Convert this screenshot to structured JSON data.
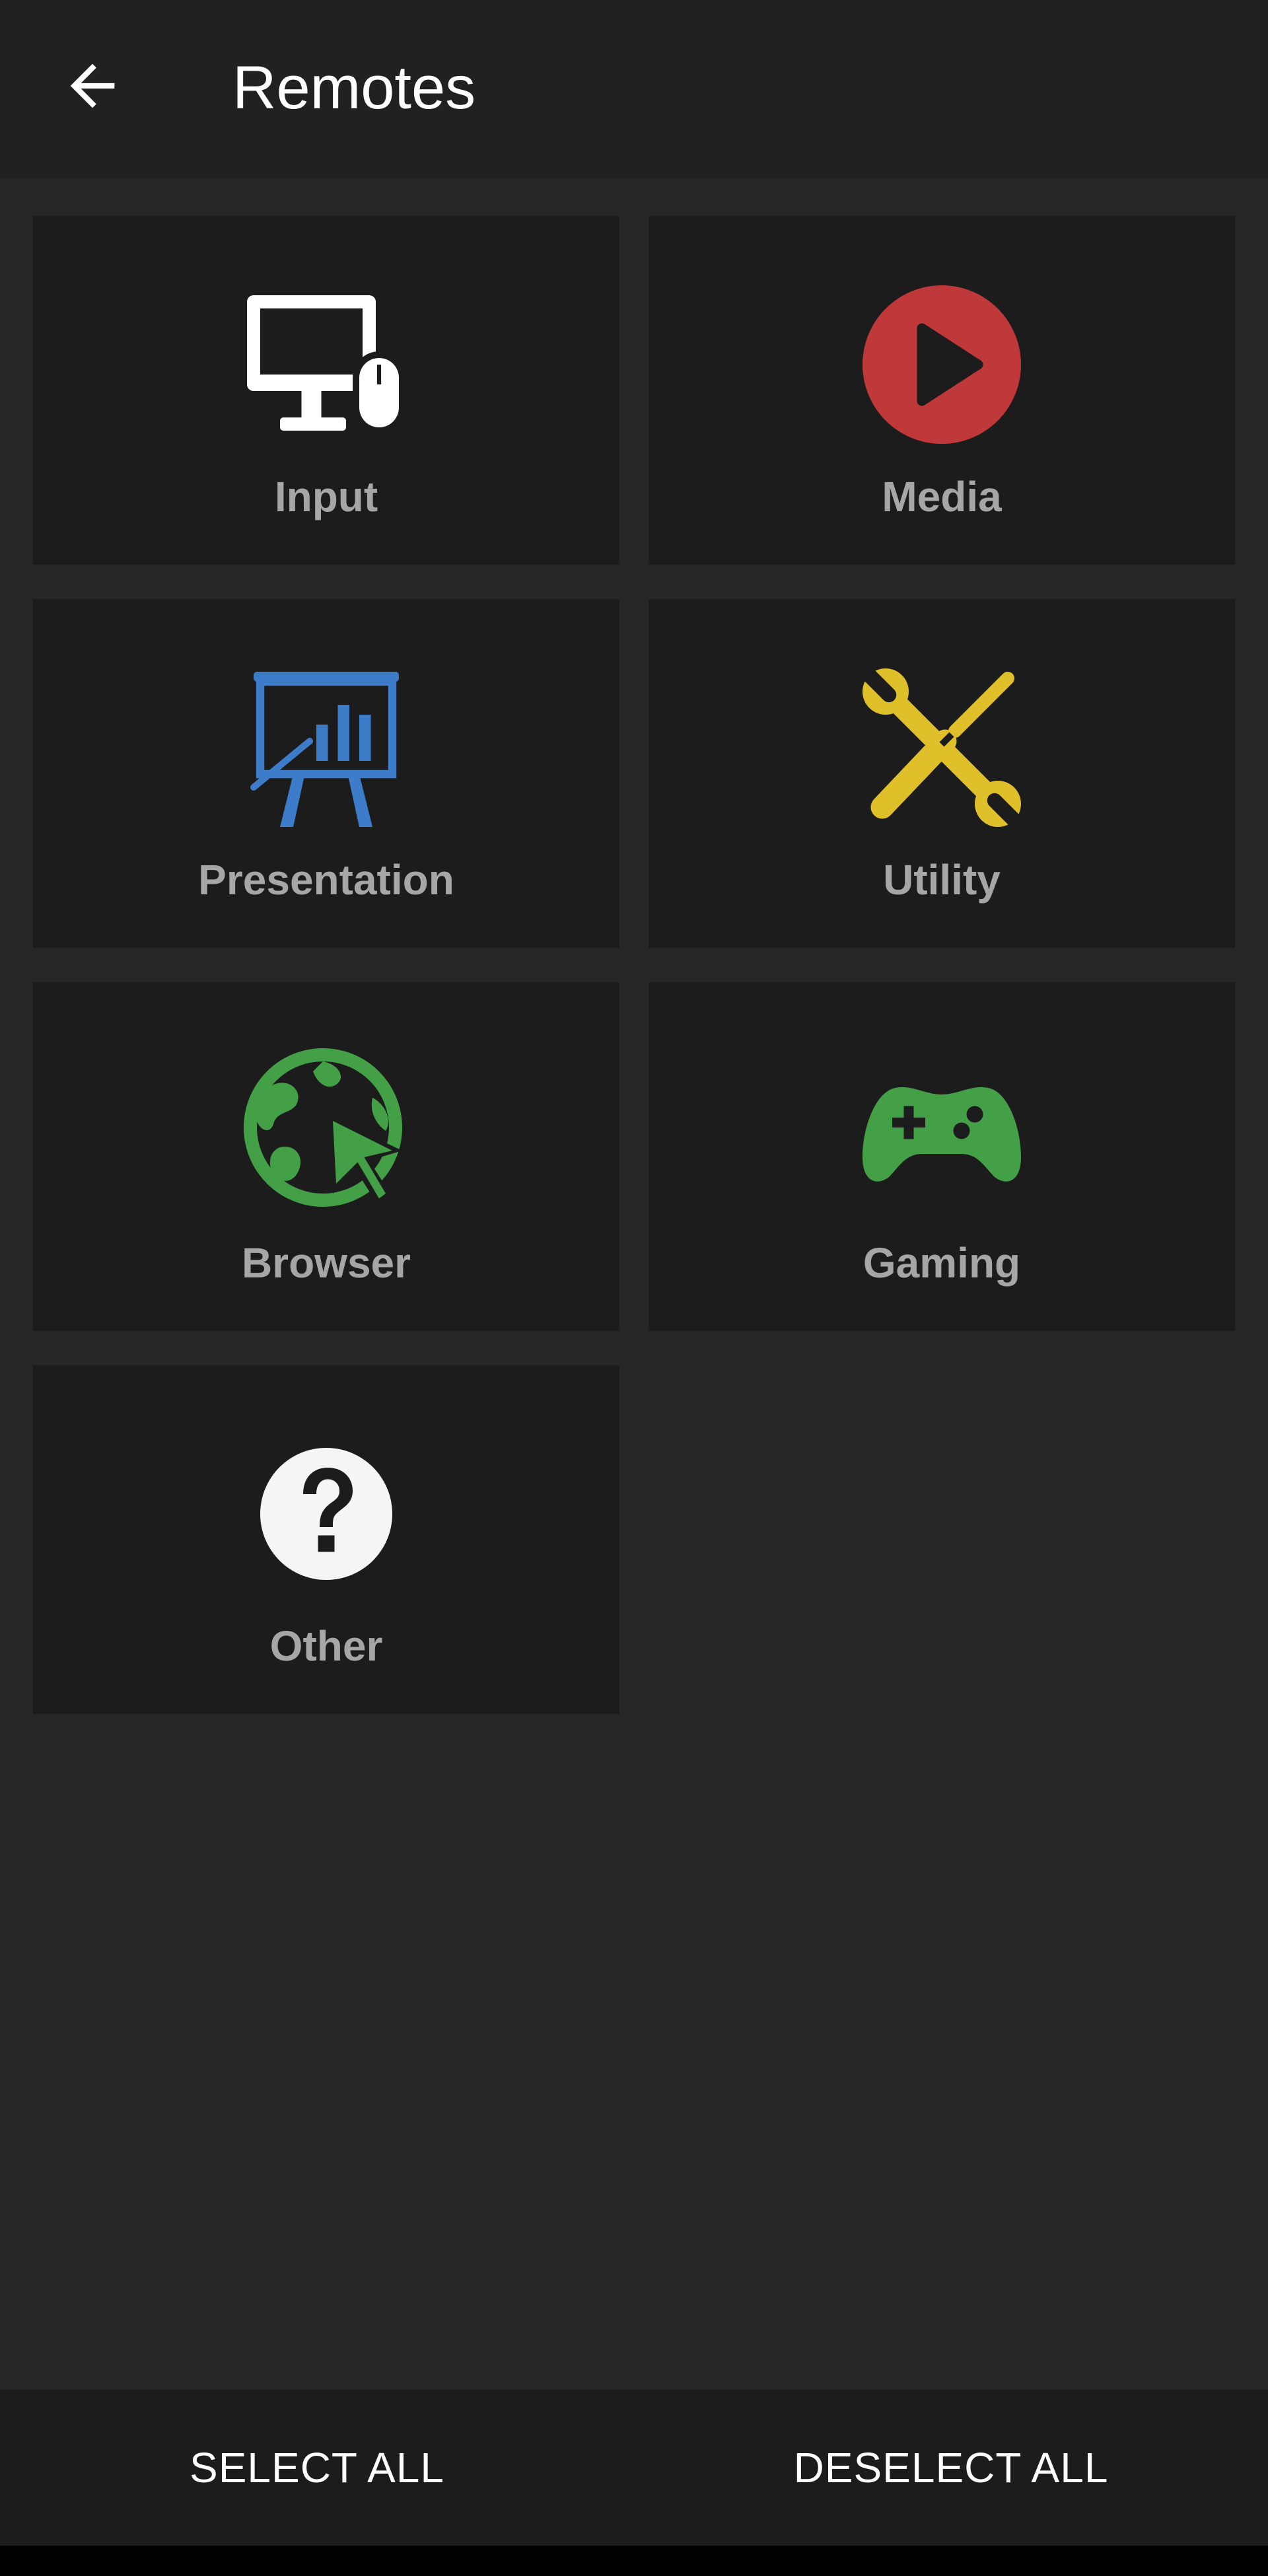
{
  "header": {
    "title": "Remotes"
  },
  "tiles": [
    {
      "label": "Input",
      "icon": "monitor-mouse-icon",
      "color": "#ffffff"
    },
    {
      "label": "Media",
      "icon": "play-circle-icon",
      "color": "#c0393a"
    },
    {
      "label": "Presentation",
      "icon": "presentation-board-icon",
      "color": "#3d7cc9"
    },
    {
      "label": "Utility",
      "icon": "wrench-screwdriver-icon",
      "color": "#e0c02a"
    },
    {
      "label": "Browser",
      "icon": "globe-cursor-icon",
      "color": "#43a047"
    },
    {
      "label": "Gaming",
      "icon": "gamepad-icon",
      "color": "#43a047"
    },
    {
      "label": "Other",
      "icon": "question-circle-icon",
      "color": "#ffffff"
    }
  ],
  "footer": {
    "select_all": "SELECT ALL",
    "deselect_all": "DESELECT ALL"
  }
}
